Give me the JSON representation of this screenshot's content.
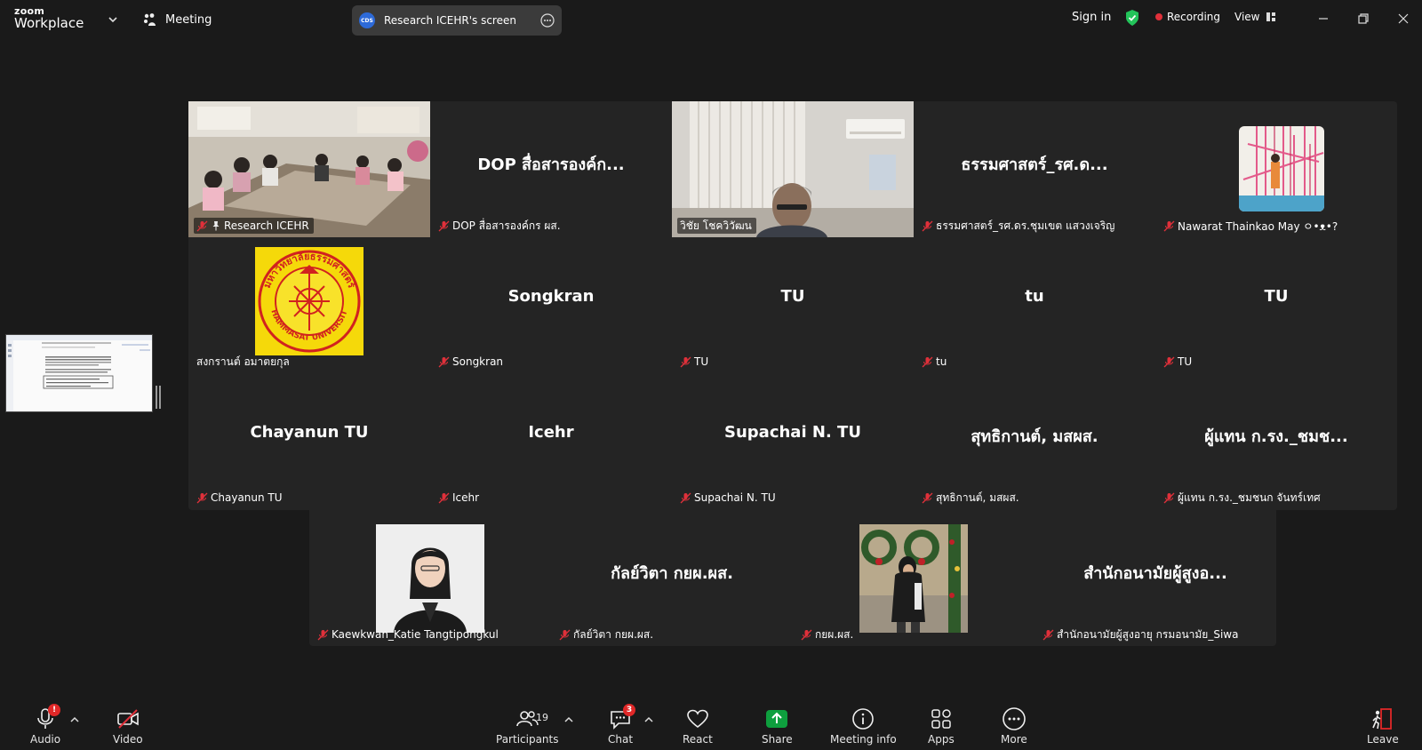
{
  "app": {
    "brand_top": "zoom",
    "brand_bottom": "Workplace"
  },
  "topbar": {
    "meeting_label": "Meeting",
    "share_title": "Research ICEHR's screen",
    "share_logo_text": "CDS",
    "signin_label": "Sign in",
    "recording_label": "Recording",
    "view_label": "View"
  },
  "tiles": [
    {
      "name": "",
      "caption": "Research ICEHR",
      "muted": true,
      "pinned": true,
      "kind": "video-room"
    },
    {
      "name": "DOP สื่อสารองค์ก...",
      "caption": "DOP สื่อสารองค์กร ผส.",
      "muted": true
    },
    {
      "name": "",
      "caption": "วิชัย โชควิวัฒน",
      "muted": false,
      "kind": "video-speaker",
      "active": true
    },
    {
      "name": "ธรรมศาสตร์_รศ.ด...",
      "caption": "ธรรมศาสตร์_รศ.ดร.ชุมเขต แสวงเจริญ",
      "muted": true
    },
    {
      "name": "",
      "caption": "Nawarat Thainkao May ㅇ•ᴥ•?",
      "muted": true,
      "kind": "photo-art"
    },
    {
      "name": "",
      "caption": "สงกรานต์ อมาตยกุล",
      "muted": false,
      "kind": "photo-seal",
      "seal_text": "มหาวิทยาลัยธรรมศาสตร์",
      "seal_en": "THAMMASAT UNIVERSITY"
    },
    {
      "name": "Songkran",
      "caption": "Songkran",
      "muted": true
    },
    {
      "name": "TU",
      "caption": "TU",
      "muted": true
    },
    {
      "name": "tu",
      "caption": "tu",
      "muted": true
    },
    {
      "name": "TU",
      "caption": "TU",
      "muted": true
    },
    {
      "name": "Chayanun TU",
      "caption": "Chayanun TU",
      "muted": true
    },
    {
      "name": "Icehr",
      "caption": "Icehr",
      "muted": true
    },
    {
      "name": "Supachai N. TU",
      "caption": "Supachai N. TU",
      "muted": true
    },
    {
      "name": "สุทธิกานต์, มสผส.",
      "caption": "สุทธิกานต์, มสผส.",
      "muted": true
    },
    {
      "name": "ผู้แทน ก.รง._ชมช...",
      "caption": "ผู้แทน ก.รง._ชมชนก จันทร์เทศ",
      "muted": true
    },
    {
      "name": "",
      "caption": "Kaewkwan_Katie Tangtipongkul",
      "muted": true,
      "kind": "photo-portrait"
    },
    {
      "name": "กัลย์วิตา กยผ.ผส.",
      "caption": "กัลย์วิตา กยผ.ผส.",
      "muted": true
    },
    {
      "name": "",
      "caption": "กยผ.ผส.",
      "muted": true,
      "kind": "photo-wreath"
    },
    {
      "name": "สำนักอนามัยผู้สูงอ...",
      "caption": "สำนักอนามัยผู้สูงอายุ กรมอนามัย_Siwa",
      "muted": true
    }
  ],
  "toolbar": {
    "audio_label": "Audio",
    "audio_badge": "!",
    "video_label": "Video",
    "participants_label": "Participants",
    "participants_count": "19",
    "chat_label": "Chat",
    "chat_badge": "3",
    "react_label": "React",
    "share_label": "Share",
    "info_label": "Meeting info",
    "apps_label": "Apps",
    "more_label": "More",
    "leave_label": "Leave"
  },
  "colors": {
    "background": "#1a1a1a",
    "tile": "#242424",
    "active_speaker": "#23d959",
    "share_green": "#0e9f3e",
    "muted_red": "#e0303a",
    "leave_red": "#e02828"
  },
  "icons": {
    "mic": "microphone-icon",
    "mic_off": "mic-muted-icon",
    "video_off": "video-off-icon",
    "participants": "people-icon",
    "chat": "chat-bubble-icon",
    "react": "heart-icon",
    "share": "share-arrow-icon",
    "info": "info-icon",
    "apps": "apps-icon",
    "more": "ellipsis-icon",
    "leave": "door-exit-icon"
  }
}
